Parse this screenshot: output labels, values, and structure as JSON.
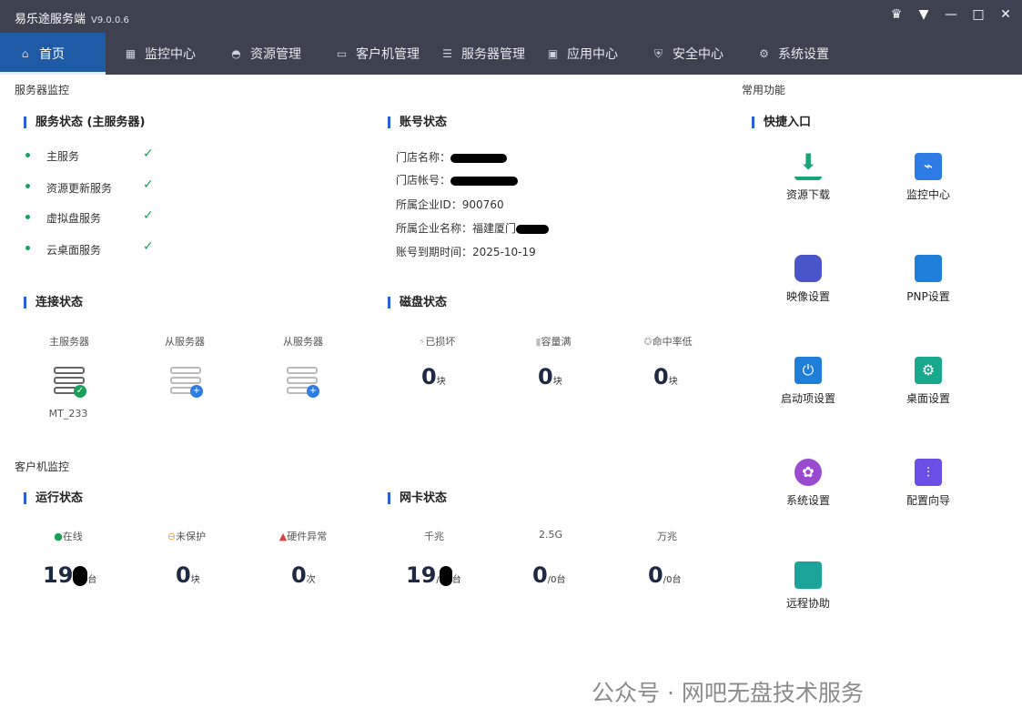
{
  "titlebar": {
    "title": "易乐途服务端",
    "version": "V9.0.0.6",
    "controls": [
      "shirt-icon",
      "menu-down-icon",
      "minimize-icon",
      "maximize-icon",
      "close-icon"
    ]
  },
  "nav": {
    "items": [
      {
        "label": "首页",
        "icon": "home-icon",
        "active": true
      },
      {
        "label": "监控中心",
        "icon": "chart-icon"
      },
      {
        "label": "资源管理",
        "icon": "gamepad-icon"
      },
      {
        "label": "客户机管理",
        "icon": "monitor-icon"
      },
      {
        "label": "服务器管理",
        "icon": "server-icon"
      },
      {
        "label": "应用中心",
        "icon": "box-icon"
      },
      {
        "label": "安全中心",
        "icon": "shield-icon"
      },
      {
        "label": "系统设置",
        "icon": "gear-icon"
      }
    ]
  },
  "server_monitor": {
    "section": "服务器监控",
    "service_status": {
      "title": "服务状态 (主服务器)",
      "items": [
        "主服务",
        "资源更新服务",
        "虚拟盘服务",
        "云桌面服务"
      ]
    },
    "account_status": {
      "title": "账号状态",
      "store_name_label": "门店名称：",
      "store_account_label": "门店帐号：",
      "enterprise_id": "所属企业ID：900760",
      "enterprise_name_label": "所属企业名称：福建厦门",
      "expiry": "账号到期时间：2025-10-19"
    },
    "connection_status": {
      "title": "连接状态",
      "servers": [
        {
          "label": "主服务器",
          "name": "MT_233"
        },
        {
          "label": "从服务器",
          "name": ""
        },
        {
          "label": "从服务器",
          "name": ""
        }
      ]
    },
    "disk_status": {
      "title": "磁盘状态",
      "items": [
        {
          "label": "已损坏",
          "value": "0",
          "unit": "块"
        },
        {
          "label": "容量满",
          "value": "0",
          "unit": "块"
        },
        {
          "label": "命中率低",
          "value": "0",
          "unit": "块"
        }
      ]
    }
  },
  "client_monitor": {
    "section": "客户机监控",
    "run_status": {
      "title": "运行状态",
      "items": [
        {
          "label": "在线",
          "value": "19",
          "unit": "台"
        },
        {
          "label": "未保护",
          "value": "0",
          "unit": "块"
        },
        {
          "label": "硬件异常",
          "value": "0",
          "unit": "次"
        }
      ]
    },
    "nic_status": {
      "title": "网卡状态",
      "items": [
        {
          "label": "千兆",
          "value": "19",
          "suffix": "/",
          "unit": "台"
        },
        {
          "label": "2.5G",
          "value": "0",
          "suffix": "/0",
          "unit": "台"
        },
        {
          "label": "万兆",
          "value": "0",
          "suffix": "/0",
          "unit": "台"
        }
      ]
    }
  },
  "common": {
    "section": "常用功能",
    "quick_title": "快捷入口",
    "items": [
      {
        "label": "资源下载",
        "icon": "download-icon",
        "color": "#19a57a"
      },
      {
        "label": "监控中心",
        "icon": "monitor-chart-icon",
        "color": "#2d7be5"
      },
      {
        "label": "映像设置",
        "icon": "disk-image-icon",
        "color": "#4a55c9"
      },
      {
        "label": "PNP设置",
        "icon": "pnp-card-icon",
        "color": "#1f7ed8"
      },
      {
        "label": "启动项设置",
        "icon": "power-calendar-icon",
        "color": "#1f7ed8"
      },
      {
        "label": "桌面设置",
        "icon": "desktop-gear-icon",
        "color": "#18a98d"
      },
      {
        "label": "系统设置",
        "icon": "flower-gear-icon",
        "color": "#9b4bd0"
      },
      {
        "label": "配置向导",
        "icon": "sliders-icon",
        "color": "#6b4ee6"
      },
      {
        "label": "远程协助",
        "icon": "remote-screen-icon",
        "color": "#1ba59a"
      }
    ]
  },
  "watermark": "公众号 · 网吧无盘技术服务"
}
